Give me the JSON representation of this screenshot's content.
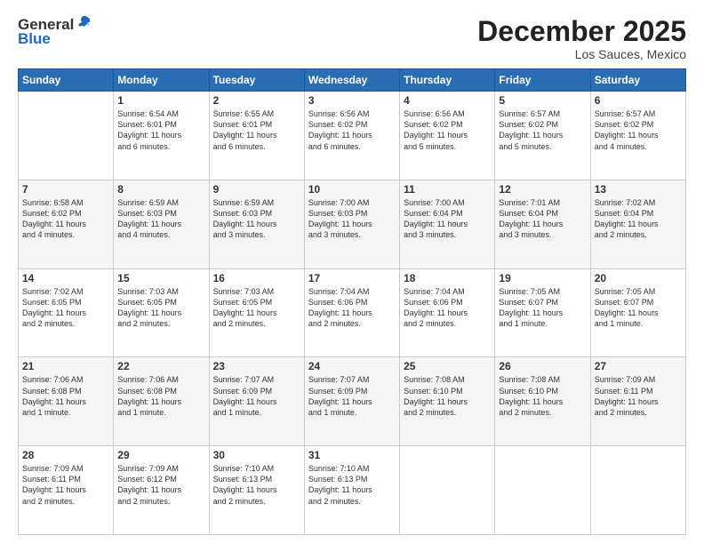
{
  "header": {
    "logo_general": "General",
    "logo_blue": "Blue",
    "month_title": "December 2025",
    "location": "Los Sauces, Mexico"
  },
  "calendar": {
    "days_of_week": [
      "Sunday",
      "Monday",
      "Tuesday",
      "Wednesday",
      "Thursday",
      "Friday",
      "Saturday"
    ],
    "weeks": [
      [
        {
          "day": "",
          "info": ""
        },
        {
          "day": "1",
          "info": "Sunrise: 6:54 AM\nSunset: 6:01 PM\nDaylight: 11 hours\nand 6 minutes."
        },
        {
          "day": "2",
          "info": "Sunrise: 6:55 AM\nSunset: 6:01 PM\nDaylight: 11 hours\nand 6 minutes."
        },
        {
          "day": "3",
          "info": "Sunrise: 6:56 AM\nSunset: 6:02 PM\nDaylight: 11 hours\nand 6 minutes."
        },
        {
          "day": "4",
          "info": "Sunrise: 6:56 AM\nSunset: 6:02 PM\nDaylight: 11 hours\nand 5 minutes."
        },
        {
          "day": "5",
          "info": "Sunrise: 6:57 AM\nSunset: 6:02 PM\nDaylight: 11 hours\nand 5 minutes."
        },
        {
          "day": "6",
          "info": "Sunrise: 6:57 AM\nSunset: 6:02 PM\nDaylight: 11 hours\nand 4 minutes."
        }
      ],
      [
        {
          "day": "7",
          "info": "Sunrise: 6:58 AM\nSunset: 6:02 PM\nDaylight: 11 hours\nand 4 minutes."
        },
        {
          "day": "8",
          "info": "Sunrise: 6:59 AM\nSunset: 6:03 PM\nDaylight: 11 hours\nand 4 minutes."
        },
        {
          "day": "9",
          "info": "Sunrise: 6:59 AM\nSunset: 6:03 PM\nDaylight: 11 hours\nand 3 minutes."
        },
        {
          "day": "10",
          "info": "Sunrise: 7:00 AM\nSunset: 6:03 PM\nDaylight: 11 hours\nand 3 minutes."
        },
        {
          "day": "11",
          "info": "Sunrise: 7:00 AM\nSunset: 6:04 PM\nDaylight: 11 hours\nand 3 minutes."
        },
        {
          "day": "12",
          "info": "Sunrise: 7:01 AM\nSunset: 6:04 PM\nDaylight: 11 hours\nand 3 minutes."
        },
        {
          "day": "13",
          "info": "Sunrise: 7:02 AM\nSunset: 6:04 PM\nDaylight: 11 hours\nand 2 minutes."
        }
      ],
      [
        {
          "day": "14",
          "info": "Sunrise: 7:02 AM\nSunset: 6:05 PM\nDaylight: 11 hours\nand 2 minutes."
        },
        {
          "day": "15",
          "info": "Sunrise: 7:03 AM\nSunset: 6:05 PM\nDaylight: 11 hours\nand 2 minutes."
        },
        {
          "day": "16",
          "info": "Sunrise: 7:03 AM\nSunset: 6:05 PM\nDaylight: 11 hours\nand 2 minutes."
        },
        {
          "day": "17",
          "info": "Sunrise: 7:04 AM\nSunset: 6:06 PM\nDaylight: 11 hours\nand 2 minutes."
        },
        {
          "day": "18",
          "info": "Sunrise: 7:04 AM\nSunset: 6:06 PM\nDaylight: 11 hours\nand 2 minutes."
        },
        {
          "day": "19",
          "info": "Sunrise: 7:05 AM\nSunset: 6:07 PM\nDaylight: 11 hours\nand 1 minute."
        },
        {
          "day": "20",
          "info": "Sunrise: 7:05 AM\nSunset: 6:07 PM\nDaylight: 11 hours\nand 1 minute."
        }
      ],
      [
        {
          "day": "21",
          "info": "Sunrise: 7:06 AM\nSunset: 6:08 PM\nDaylight: 11 hours\nand 1 minute."
        },
        {
          "day": "22",
          "info": "Sunrise: 7:06 AM\nSunset: 6:08 PM\nDaylight: 11 hours\nand 1 minute."
        },
        {
          "day": "23",
          "info": "Sunrise: 7:07 AM\nSunset: 6:09 PM\nDaylight: 11 hours\nand 1 minute."
        },
        {
          "day": "24",
          "info": "Sunrise: 7:07 AM\nSunset: 6:09 PM\nDaylight: 11 hours\nand 1 minute."
        },
        {
          "day": "25",
          "info": "Sunrise: 7:08 AM\nSunset: 6:10 PM\nDaylight: 11 hours\nand 2 minutes."
        },
        {
          "day": "26",
          "info": "Sunrise: 7:08 AM\nSunset: 6:10 PM\nDaylight: 11 hours\nand 2 minutes."
        },
        {
          "day": "27",
          "info": "Sunrise: 7:09 AM\nSunset: 6:11 PM\nDaylight: 11 hours\nand 2 minutes."
        }
      ],
      [
        {
          "day": "28",
          "info": "Sunrise: 7:09 AM\nSunset: 6:11 PM\nDaylight: 11 hours\nand 2 minutes."
        },
        {
          "day": "29",
          "info": "Sunrise: 7:09 AM\nSunset: 6:12 PM\nDaylight: 11 hours\nand 2 minutes."
        },
        {
          "day": "30",
          "info": "Sunrise: 7:10 AM\nSunset: 6:13 PM\nDaylight: 11 hours\nand 2 minutes."
        },
        {
          "day": "31",
          "info": "Sunrise: 7:10 AM\nSunset: 6:13 PM\nDaylight: 11 hours\nand 2 minutes."
        },
        {
          "day": "",
          "info": ""
        },
        {
          "day": "",
          "info": ""
        },
        {
          "day": "",
          "info": ""
        }
      ]
    ]
  }
}
